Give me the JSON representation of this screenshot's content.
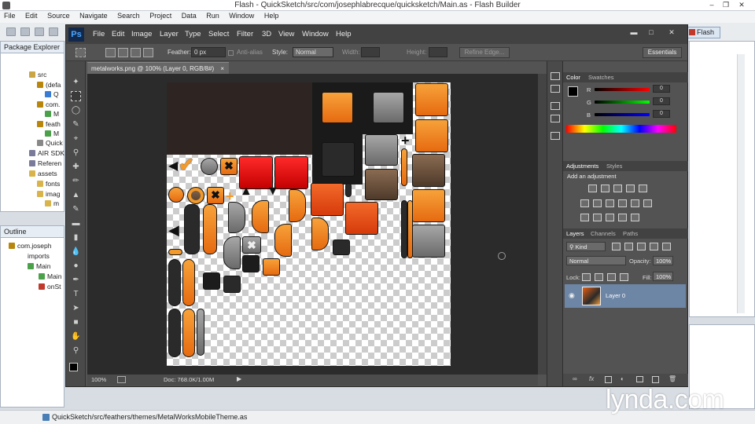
{
  "flash_builder": {
    "title": "Flash - QuickSketch/src/com/josephlabrecque/quicksketch/Main.as - Flash Builder",
    "menu": [
      "File",
      "Edit",
      "Source",
      "Navigate",
      "Search",
      "Project",
      "Data",
      "Run",
      "Window",
      "Help"
    ],
    "perspective": "Flash",
    "package_explorer": {
      "tab": "Package Explorer",
      "items": [
        "src",
        "(defa",
        "Q",
        "com.",
        "M",
        "feath",
        "M",
        "Quick",
        "AIR SDK",
        "Referen",
        "assets",
        "fonts",
        "imag",
        "m"
      ]
    },
    "outline": {
      "tab": "Outline",
      "items": [
        "com.joseph",
        "imports",
        "Main",
        "Main",
        "onSt"
      ]
    },
    "status_path": "QuickSketch/src/feathers/themes/MetalWorksMobileTheme.as"
  },
  "photoshop": {
    "logo": "Ps",
    "menu": [
      "File",
      "Edit",
      "Image",
      "Layer",
      "Type",
      "Select",
      "Filter",
      "3D",
      "View",
      "Window",
      "Help"
    ],
    "options": {
      "feather_label": "Feather:",
      "feather_value": "0 px",
      "antialias_label": "Anti-alias",
      "style_label": "Style:",
      "style_value": "Normal",
      "width_label": "Width:",
      "height_label": "Height:",
      "refine_edge": "Refine Edge...",
      "workspace": "Essentials"
    },
    "document": {
      "tab_label": "metalworks.png @ 100% (Layer 0, RGB/8#)",
      "zoom": "100%",
      "doc_size": "Doc: 768.0K/1.00M"
    },
    "color_panel": {
      "tabs": [
        "Color",
        "Swatches"
      ],
      "channels": [
        {
          "label": "R",
          "value": "0"
        },
        {
          "label": "G",
          "value": "0"
        },
        {
          "label": "B",
          "value": "0"
        }
      ]
    },
    "adjustments_panel": {
      "tabs": [
        "Adjustments",
        "Styles"
      ],
      "heading": "Add an adjustment"
    },
    "layers_panel": {
      "tabs": [
        "Layers",
        "Channels",
        "Paths"
      ],
      "filter": "Kind",
      "blend_mode": "Normal",
      "opacity_label": "Opacity:",
      "opacity_value": "100%",
      "lock_label": "Lock:",
      "fill_label": "Fill:",
      "fill_value": "100%",
      "layer_name": "Layer 0"
    }
  },
  "watermark": "lynda.com"
}
